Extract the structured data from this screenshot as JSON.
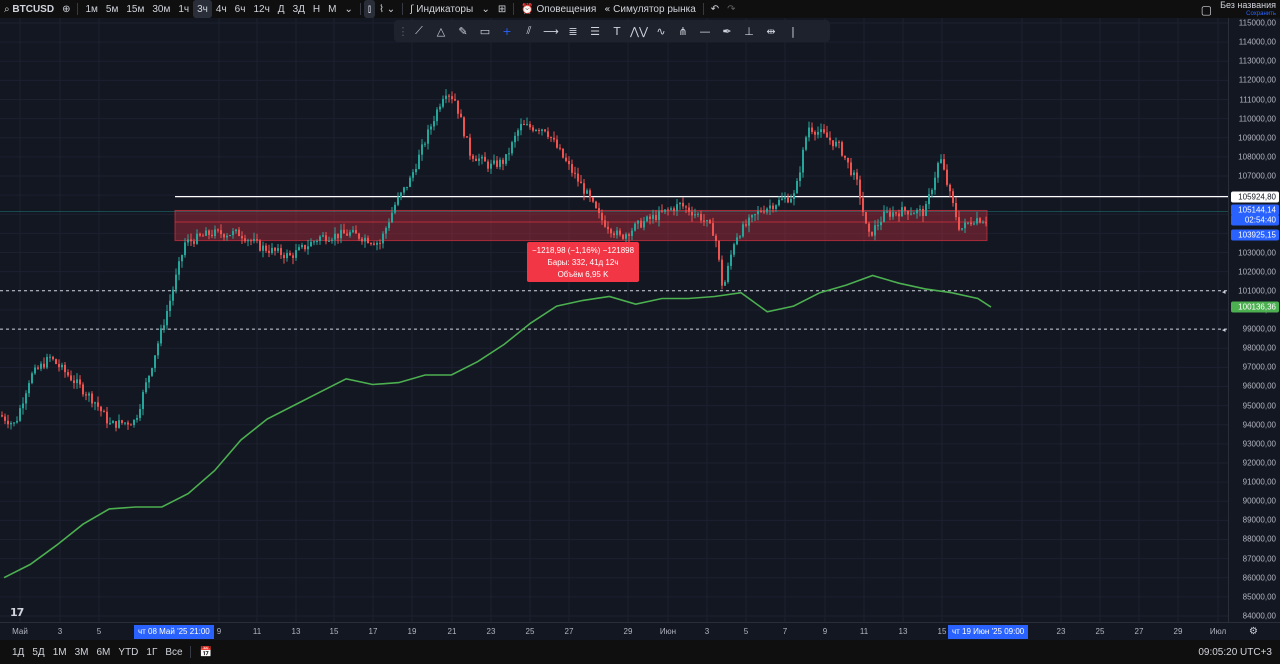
{
  "toolbar": {
    "symbol": "BTCUSD",
    "intervals": [
      "1м",
      "5м",
      "15м",
      "30м",
      "1ч",
      "3ч",
      "4ч",
      "6ч",
      "12ч",
      "Д",
      "3Д",
      "Н",
      "М"
    ],
    "active_interval": "3ч",
    "indicators_label": "Индикаторы",
    "alerts_label": "Оповещения",
    "replay_label": "Симулятор рынка",
    "layout_name": "Без названия",
    "layout_saved": "Сохранить"
  },
  "drawing_tools": [
    "trend-line-icon",
    "fib-icon",
    "brush-icon",
    "rectangle-icon",
    "crosshair-icon",
    "parallel-channel-icon",
    "ray-icon",
    "fib-retracement-icon",
    "horizontal-lines-icon",
    "text-icon",
    "pattern-icon",
    "elliott-icon",
    "pitchfork-icon",
    "horizontal-ray-icon",
    "pen-icon",
    "long-position-icon",
    "date-range-icon",
    "vertical-line-icon"
  ],
  "price_axis": {
    "labels": [
      "115000,00",
      "114000,00",
      "113000,00",
      "112000,00",
      "111000,00",
      "110000,00",
      "109000,00",
      "108000,00",
      "107000,00",
      "106000,00",
      "105000,00",
      "104000,00",
      "103000,00",
      "102000,00",
      "101000,00",
      "100000,00",
      "99000,00",
      "98000,00",
      "97000,00",
      "96000,00",
      "95000,00",
      "94000,00",
      "93000,00",
      "92000,00",
      "91000,00",
      "90000,00",
      "89000,00",
      "88000,00",
      "87000,00",
      "86000,00",
      "85000,00",
      "84000,00"
    ],
    "badges": {
      "white_line": "105924,80",
      "last_price": "105144,14",
      "countdown": "02:54:40",
      "rect_low": "103925,15",
      "ma_value": "100136,36"
    }
  },
  "time_axis": {
    "labels": [
      "Май",
      "3",
      "5",
      "9",
      "11",
      "13",
      "15",
      "17",
      "19",
      "21",
      "23",
      "25",
      "27",
      "29",
      "Июн",
      "3",
      "5",
      "7",
      "9",
      "11",
      "13",
      "15",
      "17",
      "21",
      "23",
      "25",
      "27",
      "29",
      "Июл"
    ],
    "badge_start": "чт 08 Май '25   21:00",
    "badge_end": "чт 19 Июн '25   09:00"
  },
  "tooltip": {
    "line1": "−1218,98 (−1,16%) −121898",
    "line2": "Бары: 332, 41д 12ч",
    "line3": "Объём 6,95 K"
  },
  "bottombar": {
    "ranges": [
      "1Д",
      "5Д",
      "1М",
      "3М",
      "6М",
      "YTD",
      "1Г",
      "Все"
    ],
    "time": "09:05:20 UTC+3"
  },
  "logo_text": "17",
  "colors": {
    "up": "#26a69a",
    "down": "#ef5350",
    "ma": "#4caf50",
    "accent": "#2962ff",
    "rect": "#f23645"
  },
  "chart_data": {
    "type": "candlestick",
    "ma_series": [
      [
        0,
        86000
      ],
      [
        10,
        86700
      ],
      [
        20,
        87700
      ],
      [
        30,
        88800
      ],
      [
        40,
        89600
      ],
      [
        50,
        89700
      ],
      [
        60,
        89700
      ],
      [
        70,
        90400
      ],
      [
        80,
        91600
      ],
      [
        90,
        93200
      ],
      [
        100,
        94300
      ],
      [
        110,
        95000
      ],
      [
        120,
        95700
      ],
      [
        130,
        96400
      ],
      [
        140,
        96100
      ],
      [
        150,
        96200
      ],
      [
        160,
        96600
      ],
      [
        170,
        96600
      ],
      [
        180,
        97300
      ],
      [
        190,
        98200
      ],
      [
        200,
        99300
      ],
      [
        210,
        100200
      ],
      [
        220,
        100500
      ],
      [
        230,
        100700
      ],
      [
        240,
        100300
      ],
      [
        250,
        100600
      ],
      [
        260,
        100600
      ],
      [
        270,
        100700
      ],
      [
        280,
        100900
      ],
      [
        290,
        99900
      ],
      [
        300,
        100200
      ],
      [
        310,
        100900
      ],
      [
        320,
        101300
      ],
      [
        330,
        101800
      ],
      [
        340,
        101400
      ],
      [
        350,
        101100
      ],
      [
        360,
        100900
      ],
      [
        370,
        100600
      ],
      [
        375,
        100150
      ]
    ],
    "white_line": 105924.8,
    "rect_zone": [
      103925.15,
      104900
    ],
    "dashed_lines": [
      101000,
      99000
    ]
  }
}
